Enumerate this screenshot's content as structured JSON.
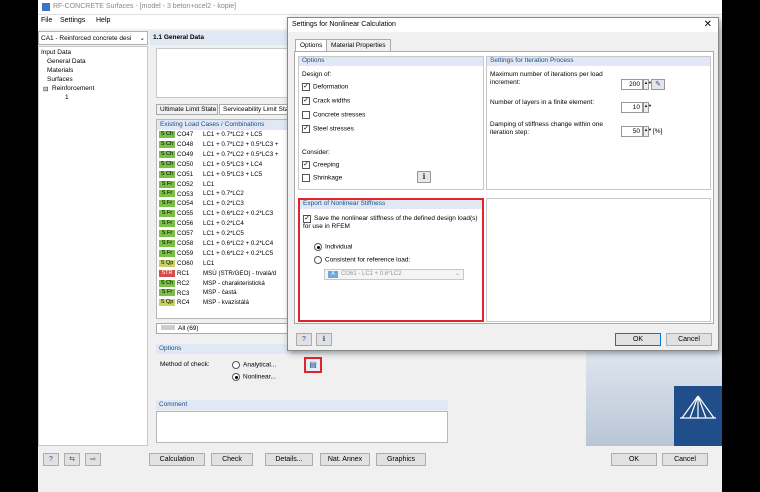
{
  "window": {
    "title": "RF-CONCRETE Surfaces - [model - 3 beton+ocel2 - kopie]"
  },
  "menu": [
    "File",
    "Settings",
    "Help"
  ],
  "case_selector": "CA1 - Reinforced concrete desi",
  "nav": {
    "root": "Input Data",
    "items": [
      "General Data",
      "Materials",
      "Surfaces",
      "Reinforcement",
      "1"
    ]
  },
  "section_title": "1.1 General Data",
  "limit_tabs": [
    "Ultimate Limit State",
    "Serviceability Limit State"
  ],
  "load_cases": {
    "header": "Existing Load Cases / Combinations",
    "rows": [
      {
        "b": "S Ch",
        "c": "g",
        "id": "CO47",
        "d": "LC1 + 0.7*LC2 + LC5"
      },
      {
        "b": "S Ch",
        "c": "g",
        "id": "CO48",
        "d": "LC1 + 0.7*LC2 + 0.5*LC3 +"
      },
      {
        "b": "S Ch",
        "c": "g",
        "id": "CO49",
        "d": "LC1 + 0.7*LC2 + 0.5*LC3 +"
      },
      {
        "b": "S Ch",
        "c": "g",
        "id": "CO50",
        "d": "LC1 + 0.5*LC3 + LC4"
      },
      {
        "b": "S Ch",
        "c": "g",
        "id": "CO51",
        "d": "LC1 + 0.5*LC3 + LC5"
      },
      {
        "b": "S Fr",
        "c": "g",
        "id": "CO52",
        "d": "LC1"
      },
      {
        "b": "S Fr",
        "c": "g",
        "id": "CO53",
        "d": "LC1 + 0.7*LC2"
      },
      {
        "b": "S Fr",
        "c": "g",
        "id": "CO54",
        "d": "LC1 + 0.2*LC3"
      },
      {
        "b": "S Fr",
        "c": "g",
        "id": "CO55",
        "d": "LC1 + 0.6*LC2 + 0.2*LC3"
      },
      {
        "b": "S Fr",
        "c": "g",
        "id": "CO56",
        "d": "LC1 + 0.2*LC4"
      },
      {
        "b": "S Fr",
        "c": "g",
        "id": "CO57",
        "d": "LC1 + 0.2*LC5"
      },
      {
        "b": "S Fr",
        "c": "g",
        "id": "CO58",
        "d": "LC1 + 0.6*LC2 + 0.2*LC4"
      },
      {
        "b": "S Fr",
        "c": "g",
        "id": "CO59",
        "d": "LC1 + 0.6*LC2 + 0.2*LC5"
      },
      {
        "b": "S Qp",
        "c": "y",
        "id": "CO60",
        "d": "LC1"
      },
      {
        "b": "STR",
        "c": "r",
        "id": "RC1",
        "d": "MSÚ (STR/GEO) - trvalá/d"
      },
      {
        "b": "S Ch",
        "c": "g",
        "id": "RC2",
        "d": "MSP - charakteristická"
      },
      {
        "b": "S Fr",
        "c": "g",
        "id": "RC3",
        "d": "MSP - častá"
      },
      {
        "b": "S Qp",
        "c": "y",
        "id": "RC4",
        "d": "MSP - kvazistálá"
      }
    ],
    "filter": "All (69)"
  },
  "options": {
    "header": "Options",
    "method_label": "Method of check:",
    "analytical": "Analytical...",
    "nonlinear": "Nonlinear..."
  },
  "comment_label": "Comment",
  "bottom_buttons": [
    "Calculation",
    "Check",
    "Details...",
    "Nat. Annex",
    "Graphics"
  ],
  "ok": "OK",
  "cancel": "Cancel",
  "dialog": {
    "title": "Settings for Nonlinear Calculation",
    "tabs": [
      "Options",
      "Material Properties"
    ],
    "options_panel": {
      "header": "Options",
      "design_of": "Design of:",
      "items": [
        {
          "label": "Deformation",
          "checked": true
        },
        {
          "label": "Crack widths",
          "checked": true
        },
        {
          "label": "Concrete stresses",
          "checked": false
        },
        {
          "label": "Steel stresses",
          "checked": true
        }
      ],
      "consider": "Consider:",
      "consider_items": [
        {
          "label": "Creeping",
          "checked": true
        },
        {
          "label": "Shrinkage",
          "checked": false
        }
      ]
    },
    "iteration_panel": {
      "header": "Settings for Iteration Process",
      "max_iter_label": "Maximum number of iterations per load increment:",
      "max_iter": "200",
      "layers_label": "Number of layers in a finite element:",
      "layers": "10",
      "damping_label": "Damping of stiffness change within one iteration step:",
      "damping": "50",
      "damping_unit": "[%]"
    },
    "export_panel": {
      "header": "Export of Nonlinear Stiffness",
      "save_label": "Save the nonlinear stiffness of the defined design load(s) for use in RFEM",
      "individual": "Individual",
      "consistent": "Consistent for reference load:",
      "ref_badge": "A",
      "ref_value": "CO61 - LC1 + 0.6*LC2"
    },
    "ok": "OK",
    "cancel": "Cancel",
    "highlight_color": "#e0242c"
  }
}
